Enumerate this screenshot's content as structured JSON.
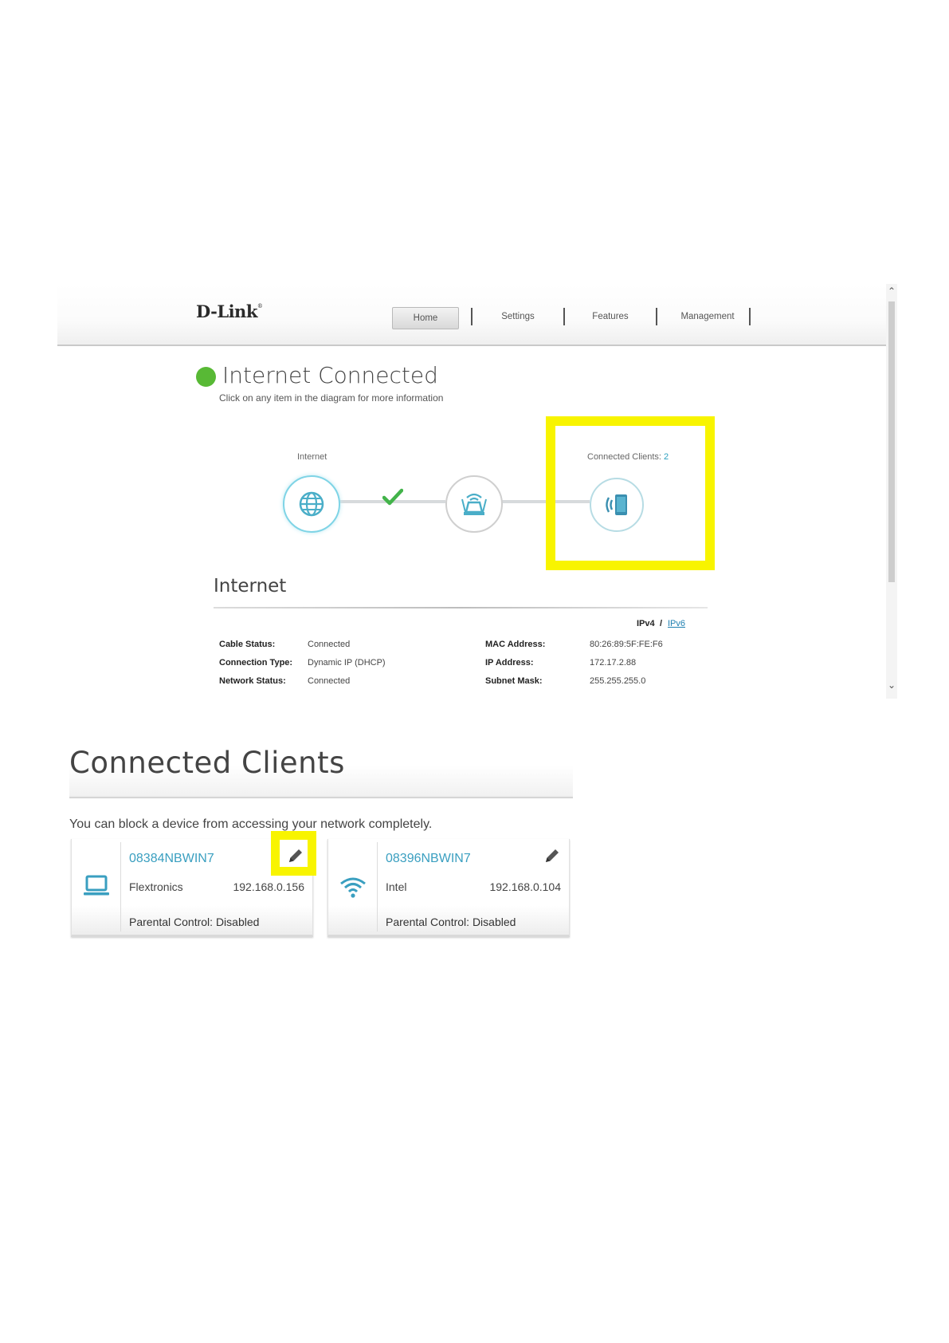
{
  "header": {
    "logo": "D-Link",
    "logo_mark": "®",
    "nav": {
      "home": "Home",
      "settings": "Settings",
      "features": "Features",
      "management": "Management"
    }
  },
  "status": {
    "title": "Internet Connected",
    "subtitle": "Click on any item in the diagram for more information",
    "indicator_color": "#58b935"
  },
  "diagram": {
    "internet_label": "Internet",
    "clients_label_prefix": "Connected Clients: ",
    "clients_count": "2",
    "nodes": [
      "globe-icon",
      "router-icon",
      "mobile-device-icon"
    ],
    "link_status": "check-icon"
  },
  "internet": {
    "title": "Internet",
    "ipv4": "IPv4",
    "separator": "/",
    "ipv6": "IPv6",
    "left": [
      {
        "label": "Cable Status:",
        "value": "Connected"
      },
      {
        "label": "Connection Type:",
        "value": "Dynamic IP (DHCP)"
      },
      {
        "label": "Network Status:",
        "value": "Connected"
      }
    ],
    "right": [
      {
        "label": "MAC Address:",
        "value": "80:26:89:5F:FE:F6"
      },
      {
        "label": "IP Address:",
        "value": "172.17.2.88"
      },
      {
        "label": "Subnet Mask:",
        "value": "255.255.255.0"
      }
    ]
  },
  "connected_clients": {
    "title": "Connected Clients",
    "description": "You can block a device from accessing your network completely.",
    "clients": [
      {
        "name": "08384NBWIN7",
        "vendor": "Flextronics",
        "ip": "192.168.0.156",
        "parental": "Parental Control: Disabled",
        "icon": "laptop-icon"
      },
      {
        "name": "08396NBWIN7",
        "vendor": "Intel",
        "ip": "192.168.0.104",
        "parental": "Parental Control: Disabled",
        "icon": "wifi-icon"
      }
    ]
  },
  "colors": {
    "highlight": "#f8f400",
    "accent": "#3a9fc0",
    "link": "#1e7fb0"
  }
}
